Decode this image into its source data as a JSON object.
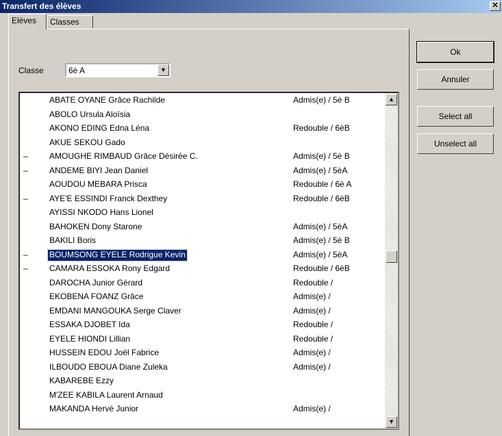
{
  "window": {
    "title": "Transfert des élèves",
    "close_glyph": "✕"
  },
  "tabs": [
    {
      "label": "Elèves"
    },
    {
      "label": "Classes"
    }
  ],
  "classe": {
    "label": "Classe",
    "value": "6è A"
  },
  "buttons": {
    "ok": "Ok",
    "cancel": "Annuler",
    "select_all": "Select all",
    "unselect_all": "Unselect all"
  },
  "icons": {
    "close": "close-icon",
    "dropdown": "chevron-down-icon",
    "scroll_up": "scroll-up-arrow-icon",
    "scroll_down": "scroll-down-arrow-icon"
  },
  "students": [
    {
      "mark": "",
      "name": "ABATE OYANE Grâce Rachilde",
      "status": "Admis(e) / 5è B"
    },
    {
      "mark": "",
      "name": "ABOLO Ursula Aloïsia",
      "status": ""
    },
    {
      "mark": "",
      "name": "AKONO EDING Edna Léna",
      "status": "Redouble / 6èB"
    },
    {
      "mark": "",
      "name": "AKUE SEKOU Gado",
      "status": ""
    },
    {
      "mark": "–",
      "name": "AMOUGHE RIMBAUD Grâce Désirée C.",
      "status": "Admis(e) / 5è B"
    },
    {
      "mark": "–",
      "name": "ANDEME BIYI Jean Daniel",
      "status": "Admis(e) / 5èA"
    },
    {
      "mark": "",
      "name": "AOUDOU MEBARA Prisca",
      "status": "Redouble / 6è A"
    },
    {
      "mark": "–",
      "name": "AYE'E ESSINDI Franck Dexthey",
      "status": "Redouble / 6èB"
    },
    {
      "mark": "",
      "name": "AYISSI NKODO Hans Lionel",
      "status": ""
    },
    {
      "mark": "",
      "name": "BAHOKEN Dony Starone",
      "status": "Admis(e) / 5èA"
    },
    {
      "mark": "",
      "name": "BAKILI Boris",
      "status": "Admis(e) / 5è B"
    },
    {
      "mark": "–",
      "name": "BOUMSONG EYELE Rodrigue Kevin",
      "status": "Admis(e) / 5èA",
      "selected": true
    },
    {
      "mark": "–",
      "name": "CAMARA ESSOKA Rony Edgard",
      "status": "Redouble / 6èB"
    },
    {
      "mark": "",
      "name": "DAROCHA Junior Gérard",
      "status": "Redouble /"
    },
    {
      "mark": "",
      "name": "EKOBENA FOANZ Grâce",
      "status": "Admis(e) /"
    },
    {
      "mark": "",
      "name": "EMDANI MANGOUKA Serge  Claver",
      "status": "Admis(e) /"
    },
    {
      "mark": "",
      "name": "ESSAKA DJOBET Ida",
      "status": "Redouble /"
    },
    {
      "mark": "",
      "name": "EYELE HIONDI Lillian",
      "status": "Redouble /"
    },
    {
      "mark": "",
      "name": "HUSSEIN EDOU Joël Fabrice",
      "status": "Admis(e) /"
    },
    {
      "mark": "",
      "name": "ILBOUDO EBOUA Diane Zuleka",
      "status": "Admis(e) /"
    },
    {
      "mark": "",
      "name": "KABAREBE Ezzy",
      "status": ""
    },
    {
      "mark": "",
      "name": "M'ZEE KABILA Laurent Arnaud",
      "status": ""
    },
    {
      "mark": "",
      "name": "MAKANDA Hervé Junior",
      "status": "Admis(e) /"
    }
  ]
}
